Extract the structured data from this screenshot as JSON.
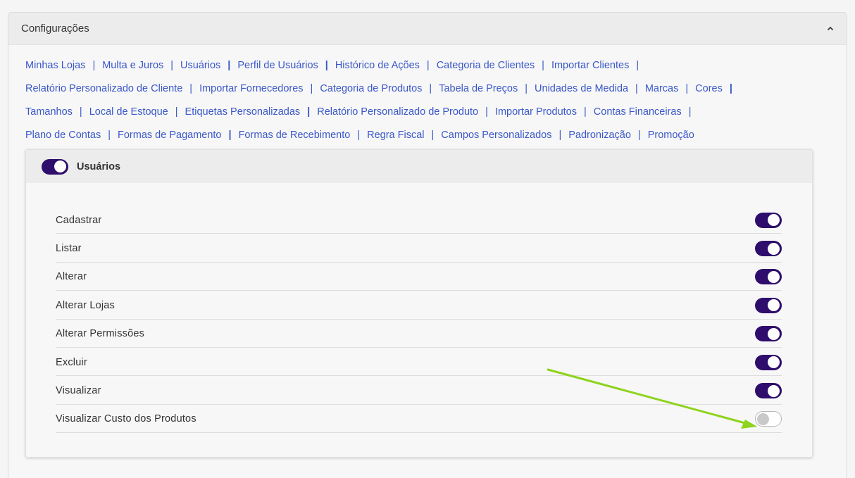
{
  "panel": {
    "title": "Configurações"
  },
  "links": [
    [
      {
        "label": "Minhas Lojas",
        "sep": "|"
      },
      {
        "label": "Multa e Juros",
        "sep": "|"
      },
      {
        "label": "Usuários",
        "sep": "|",
        "bold": true
      },
      {
        "label": "Perfil de Usuários",
        "sep": "|",
        "bold": true
      },
      {
        "label": "Histórico de Ações",
        "sep": "|"
      },
      {
        "label": "Categoria de Clientes",
        "sep": "|"
      },
      {
        "label": "Importar Clientes",
        "sep": "|"
      }
    ],
    [
      {
        "label": "Relatório Personalizado de Cliente",
        "sep": "|"
      },
      {
        "label": "Importar Fornecedores",
        "sep": "|"
      },
      {
        "label": "Categoria de Produtos",
        "sep": "|"
      },
      {
        "label": "Tabela de Preços",
        "sep": "|"
      },
      {
        "label": "Unidades de Medida",
        "sep": "|"
      },
      {
        "label": "Marcas",
        "sep": "|"
      },
      {
        "label": "Cores",
        "sep": "|",
        "bold": true
      }
    ],
    [
      {
        "label": "Tamanhos",
        "sep": "|"
      },
      {
        "label": "Local de Estoque",
        "sep": "|"
      },
      {
        "label": "Etiquetas Personalizadas",
        "sep": "|",
        "bold": true
      },
      {
        "label": "Relatório Personalizado de Produto",
        "sep": "|"
      },
      {
        "label": "Importar Produtos",
        "sep": "|"
      },
      {
        "label": "Contas Financeiras",
        "sep": "|"
      }
    ],
    [
      {
        "label": "Plano de Contas",
        "sep": "|"
      },
      {
        "label": "Formas de Pagamento",
        "sep": "|",
        "bold": true
      },
      {
        "label": "Formas de Recebimento",
        "sep": "|"
      },
      {
        "label": "Regra Fiscal",
        "sep": "|"
      },
      {
        "label": "Campos Personalizados",
        "sep": "|"
      },
      {
        "label": "Padronização",
        "sep": "|"
      },
      {
        "label": "Promoção",
        "sep": ""
      }
    ]
  ],
  "section": {
    "title": "Usuários",
    "enabled": true
  },
  "permissions": [
    {
      "label": "Cadastrar",
      "enabled": true
    },
    {
      "label": "Listar",
      "enabled": true
    },
    {
      "label": "Alterar",
      "enabled": true
    },
    {
      "label": "Alterar Lojas",
      "enabled": true
    },
    {
      "label": "Alterar Permissões",
      "enabled": true
    },
    {
      "label": "Excluir",
      "enabled": true
    },
    {
      "label": "Visualizar",
      "enabled": true
    },
    {
      "label": "Visualizar Custo dos Produtos",
      "enabled": false
    }
  ],
  "colors": {
    "toggle_on": "#2e0d6c",
    "link": "#3a57c9",
    "annotation_arrow": "#8ed31c"
  },
  "icons": {
    "collapse": "chevron-up-icon"
  }
}
